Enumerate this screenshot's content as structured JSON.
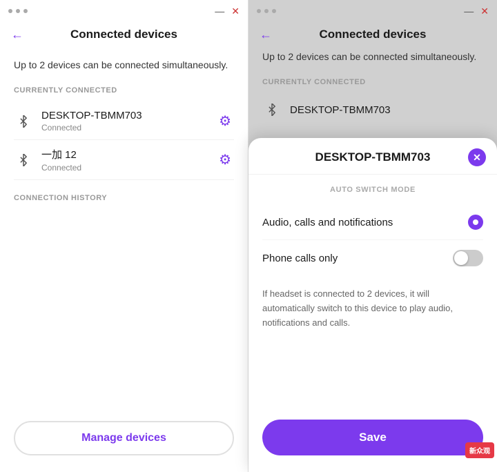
{
  "colors": {
    "accent": "#7c3aed",
    "text_dark": "#1a1a1a",
    "text_muted": "#888888",
    "text_section": "#999999",
    "border": "#f0f0f0",
    "bg_white": "#ffffff",
    "toggle_off": "#cccccc"
  },
  "left_panel": {
    "title_bar": {
      "dots": [
        "dot1",
        "dot2",
        "dot3"
      ],
      "minimize": "—",
      "close": "✕"
    },
    "header": {
      "back_arrow": "←",
      "title": "Connected devices"
    },
    "subtitle": "Up to 2 devices can be connected simultaneously.",
    "section_currently": "CURRENTLY CONNECTED",
    "devices": [
      {
        "name": "DESKTOP-TBMM703",
        "status": "Connected"
      },
      {
        "name": "一加 12",
        "status": "Connected"
      }
    ],
    "section_history": "CONNECTION HISTORY",
    "manage_btn": "Manage devices"
  },
  "right_panel": {
    "title_bar": {
      "dots": [
        "dot1",
        "dot2",
        "dot3"
      ],
      "minimize": "—",
      "close": "✕"
    },
    "header": {
      "back_arrow": "←",
      "title": "Connected devices"
    },
    "subtitle": "Up to 2 devices can be connected simultaneously.",
    "section_currently": "CURRENTLY CONNECTED",
    "device_partial": "DESKTOP-TBMM703",
    "modal": {
      "title": "DESKTOP-TBMM703",
      "close": "✕",
      "section_label": "AUTO SWITCH MODE",
      "options": [
        {
          "label": "Audio, calls and notifications",
          "type": "radio",
          "active": true
        },
        {
          "label": "Phone calls only",
          "type": "toggle",
          "active": false
        }
      ],
      "description": "If headset is connected to 2 devices, it will automatically switch to this device to play audio, notifications and calls.",
      "save_btn": "Save"
    }
  },
  "watermark": {
    "text": "新\n众观"
  }
}
